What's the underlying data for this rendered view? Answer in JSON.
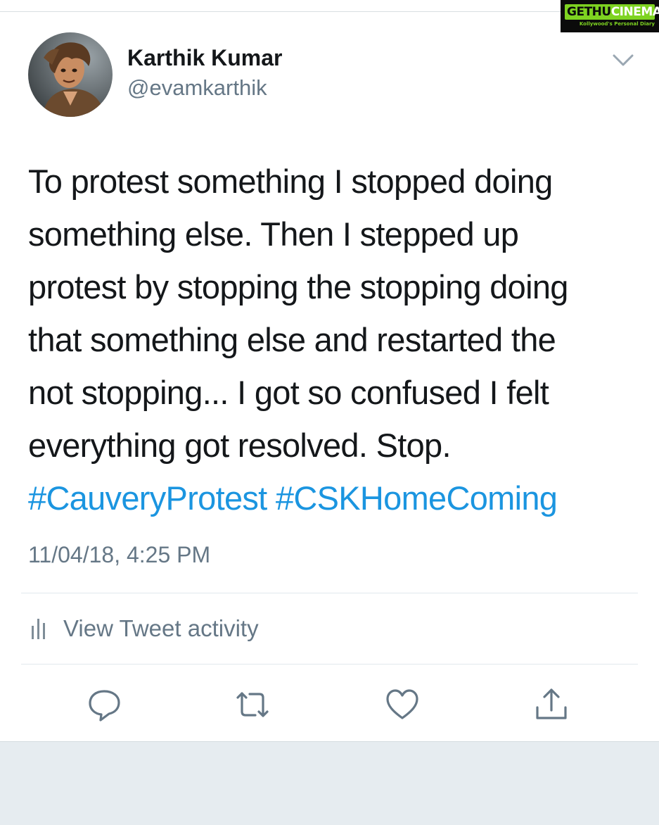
{
  "watermark": {
    "brand_part1": "GETHU",
    "brand_part2": "CINEMA",
    "tagline": "Kollywood's Personal Diary"
  },
  "tweet": {
    "author": {
      "display_name": "Karthik Kumar",
      "handle": "@evamkarthik"
    },
    "text_lines": [
      "To protest something I stopped doing",
      "something else. Then I stepped up",
      "protest by stopping the stopping doing",
      "that something else and restarted the",
      "not stopping... I got so confused I felt",
      "everything got resolved. Stop."
    ],
    "hashtags": [
      "#CauveryProtest",
      "#CSKHomeComing"
    ],
    "timestamp": "11/04/18, 4:25 PM",
    "activity_label": "View Tweet activity"
  },
  "actions": [
    "reply-icon",
    "retweet-icon",
    "like-icon",
    "share-icon"
  ],
  "colors": {
    "text": "#14171a",
    "secondary": "#657786",
    "link": "#1b95e0",
    "divider": "#e1e8ed",
    "footer_bg": "#e6ecf0"
  }
}
